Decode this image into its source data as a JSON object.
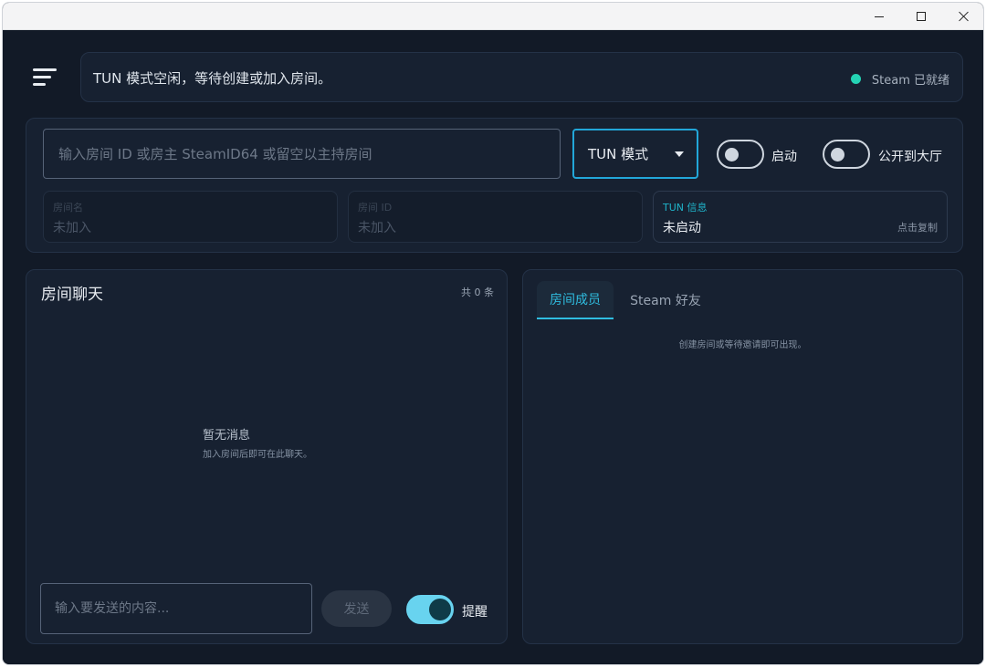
{
  "window": {
    "minimize_icon": "minimize-icon",
    "maximize_icon": "maximize-icon",
    "close_icon": "close-icon"
  },
  "header": {
    "menu_icon": "menu-icon",
    "status_text": "TUN 模式空闲，等待创建或加入房间。",
    "steam_status": "Steam 已就绪",
    "steam_status_color": "#24d3b4"
  },
  "connection": {
    "room_input_placeholder": "输入房间 ID 或房主 SteamID64 或留空以主持房间",
    "room_input_value": "",
    "mode_selected": "TUN 模式",
    "start_toggle_label": "启动",
    "start_toggle_on": false,
    "public_toggle_label": "公开到大厅",
    "public_toggle_on": false
  },
  "info_cards": [
    {
      "label": "房间名",
      "value": "未加入"
    },
    {
      "label": "房间 ID",
      "value": "未加入"
    },
    {
      "label": "TUN 信息",
      "value": "未启动",
      "action": "点击复制"
    }
  ],
  "chat": {
    "title": "房间聊天",
    "count": "共 0 条",
    "empty_title": "暂无消息",
    "empty_subtitle": "加入房间后即可在此聊天。",
    "input_placeholder": "输入要发送的内容...",
    "send_label": "发送",
    "notify_label": "提醒",
    "notify_on": true
  },
  "members": {
    "tabs": [
      {
        "label": "房间成员",
        "active": true
      },
      {
        "label": "Steam 好友",
        "active": false
      }
    ],
    "empty_text": "创建房间或等待邀请即可出现。"
  },
  "colors": {
    "accent": "#2fbde0",
    "background": "#121a27",
    "panel": "#172131"
  }
}
